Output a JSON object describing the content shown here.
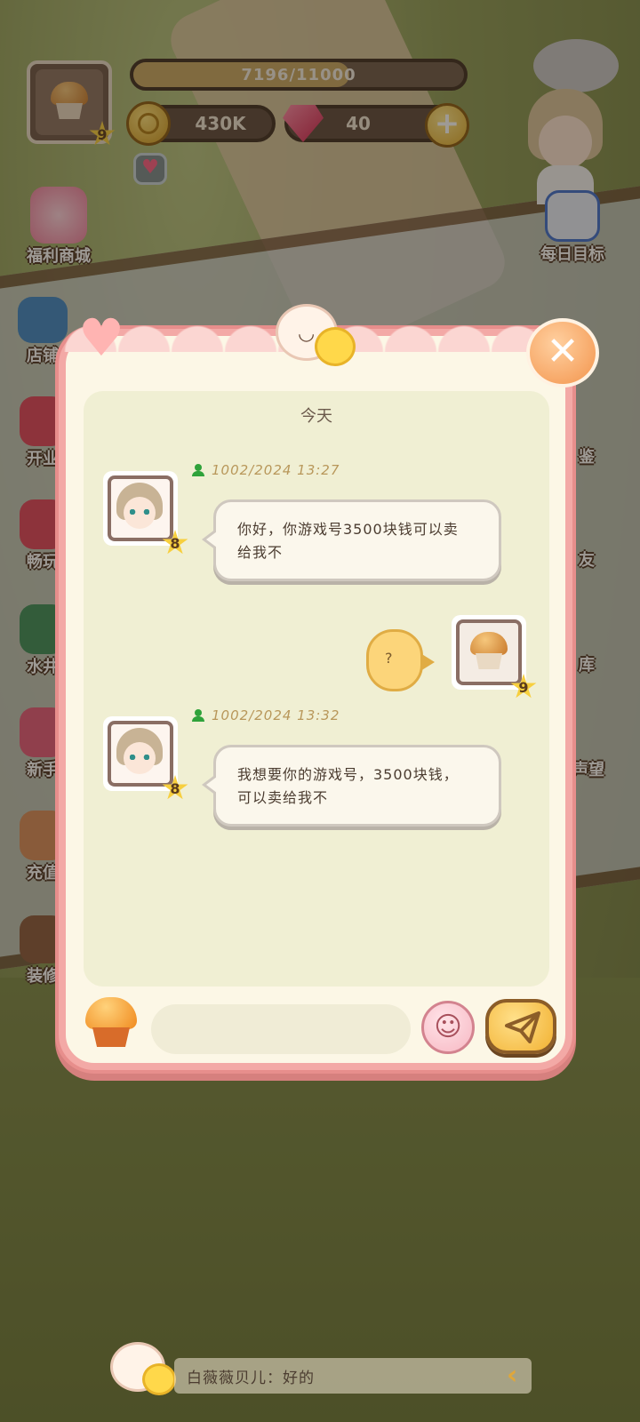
{
  "hud": {
    "player_level": "9",
    "exp_text": "7196/11000",
    "exp_progress": 0.654,
    "coins": "430K",
    "gems": "40"
  },
  "menu_left": [
    {
      "label": "福利商城",
      "icon": "gift-shop-icon"
    },
    {
      "label": "店铺",
      "icon": "camera-icon"
    },
    {
      "label": "开业",
      "icon": "gift-box-icon"
    },
    {
      "label": "畅玩",
      "icon": "gift-box-icon"
    },
    {
      "label": "水井",
      "icon": "well-icon"
    },
    {
      "label": "新手",
      "icon": "cake-icon"
    },
    {
      "label": "充值",
      "icon": "girl-icon"
    },
    {
      "label": "装修",
      "icon": "decor-icon"
    }
  ],
  "menu_right": [
    {
      "label": "每日目标",
      "icon": "calendar-icon"
    },
    {
      "label": "鉴",
      "icon": "alert-icon"
    },
    {
      "label": "友",
      "icon": "friends-icon"
    },
    {
      "label": "库",
      "icon": "warehouse-icon"
    },
    {
      "label": "声望",
      "icon": "reputation-icon"
    }
  ],
  "chat": {
    "date_label": "今天",
    "messages": [
      {
        "sender_level": "8",
        "timestamp": "1002/2024 13:27",
        "line1": "你好，你游戏号3500块钱可以卖",
        "line2": "给我不"
      },
      {
        "sender_level": "9",
        "text": "?"
      },
      {
        "sender_level": "8",
        "timestamp": "1002/2024 13:32",
        "line1": "我想要你的游戏号，3500块钱，",
        "line2": "可以卖给我不"
      }
    ],
    "input_value": ""
  },
  "ticker": {
    "sender": "白薇薇贝儿",
    "separator": "：",
    "text": "好的"
  },
  "colors": {
    "dialog_border": "#f3a9a6",
    "dialog_bg": "#fcf7e6",
    "send_button": "#f2b233"
  }
}
